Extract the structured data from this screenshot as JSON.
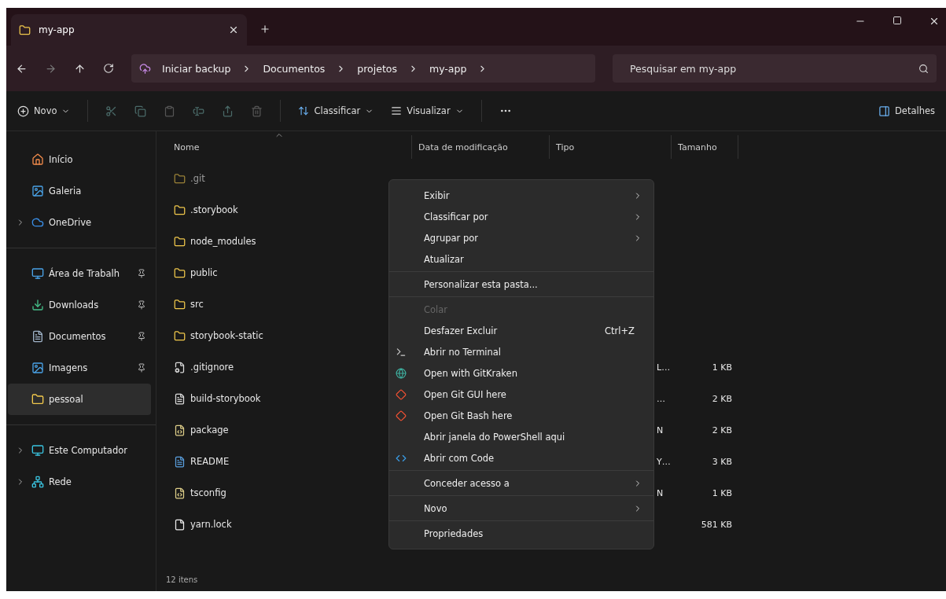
{
  "tab": {
    "title": "my-app"
  },
  "nav": {
    "backup_label": "Iniciar backup",
    "breadcrumbs": [
      "Documentos",
      "projetos",
      "my-app"
    ],
    "search": {
      "placeholder": "Pesquisar em my-app"
    }
  },
  "toolbar": {
    "new_label": "Novo",
    "sort_label": "Classificar",
    "view_label": "Visualizar",
    "details_label": "Detalhes"
  },
  "sidebar": {
    "groups": [
      [
        {
          "label": "Início",
          "kind": "home",
          "expandable": false,
          "pinned": false,
          "selected": false
        },
        {
          "label": "Galeria",
          "kind": "gallery",
          "expandable": false,
          "pinned": false,
          "selected": false
        },
        {
          "label": "OneDrive",
          "kind": "cloud",
          "expandable": true,
          "pinned": false,
          "selected": false
        }
      ],
      [
        {
          "label": "Área de Trabalh",
          "kind": "desktop",
          "expandable": false,
          "pinned": true,
          "selected": false
        },
        {
          "label": "Downloads",
          "kind": "download",
          "expandable": false,
          "pinned": true,
          "selected": false
        },
        {
          "label": "Documentos",
          "kind": "docs",
          "expandable": false,
          "pinned": true,
          "selected": false
        },
        {
          "label": "Imagens",
          "kind": "gallery",
          "expandable": false,
          "pinned": true,
          "selected": false
        },
        {
          "label": "pessoal",
          "kind": "folder",
          "expandable": false,
          "pinned": false,
          "selected": true
        }
      ],
      [
        {
          "label": "Este Computador",
          "kind": "pc",
          "expandable": true,
          "pinned": false,
          "selected": false
        },
        {
          "label": "Rede",
          "kind": "network",
          "expandable": true,
          "pinned": false,
          "selected": false
        }
      ]
    ]
  },
  "table": {
    "columns": [
      "Nome",
      "Data de modificação",
      "Tipo",
      "Tamanho"
    ],
    "rows": [
      {
        "name": ".git",
        "kind": "folder",
        "hidden": true
      },
      {
        "name": ".storybook",
        "kind": "folder",
        "hidden": false
      },
      {
        "name": "node_modules",
        "kind": "folder",
        "hidden": false
      },
      {
        "name": "public",
        "kind": "folder",
        "hidden": false
      },
      {
        "name": "src",
        "kind": "folder",
        "hidden": false
      },
      {
        "name": "storybook-static",
        "kind": "folder",
        "hidden": false
      },
      {
        "name": ".gitignore",
        "kind": "config",
        "hidden": false,
        "type": "L…",
        "size": "1 KB"
      },
      {
        "name": "build-storybook",
        "kind": "doc",
        "hidden": false,
        "type": "…",
        "size": "2 KB"
      },
      {
        "name": "package",
        "kind": "json",
        "hidden": false,
        "type": "N",
        "size": "2 KB"
      },
      {
        "name": "README",
        "kind": "markdown",
        "hidden": false,
        "type": "Y…",
        "size": "3 KB"
      },
      {
        "name": "tsconfig",
        "kind": "json",
        "hidden": false,
        "type": "N",
        "size": "1 KB"
      },
      {
        "name": "yarn.lock",
        "kind": "blank",
        "hidden": false,
        "size": "581 KB"
      }
    ]
  },
  "context_menu": {
    "groups": [
      [
        {
          "label": "Exibir",
          "submenu": true,
          "disabled": false
        },
        {
          "label": "Classificar por",
          "submenu": true,
          "disabled": false
        },
        {
          "label": "Agrupar por",
          "submenu": true,
          "disabled": false
        },
        {
          "label": "Atualizar",
          "submenu": false,
          "disabled": false
        }
      ],
      [
        {
          "label": "Personalizar esta pasta...",
          "submenu": false,
          "disabled": false
        }
      ],
      [
        {
          "label": "Colar",
          "submenu": false,
          "disabled": true
        },
        {
          "label": "Desfazer Excluir",
          "submenu": false,
          "disabled": false,
          "shortcut": "Ctrl+Z"
        },
        {
          "label": "Abrir no Terminal",
          "submenu": false,
          "disabled": false,
          "kind": "terminal"
        },
        {
          "label": "Open with GitKraken",
          "submenu": false,
          "disabled": false,
          "kind": "kraken"
        },
        {
          "label": "Open Git GUI here",
          "submenu": false,
          "disabled": false,
          "kind": "git"
        },
        {
          "label": "Open Git Bash here",
          "submenu": false,
          "disabled": false,
          "kind": "git"
        },
        {
          "label": "Abrir janela do PowerShell aqui",
          "submenu": false,
          "disabled": false
        },
        {
          "label": "Abrir com Code",
          "submenu": false,
          "disabled": false,
          "kind": "code"
        }
      ],
      [
        {
          "label": "Conceder acesso a",
          "submenu": true,
          "disabled": false
        }
      ],
      [
        {
          "label": "Novo",
          "submenu": true,
          "disabled": false
        }
      ],
      [
        {
          "label": "Propriedades",
          "submenu": false,
          "disabled": false
        }
      ]
    ]
  },
  "status_bar": {
    "count": "12 itens"
  }
}
